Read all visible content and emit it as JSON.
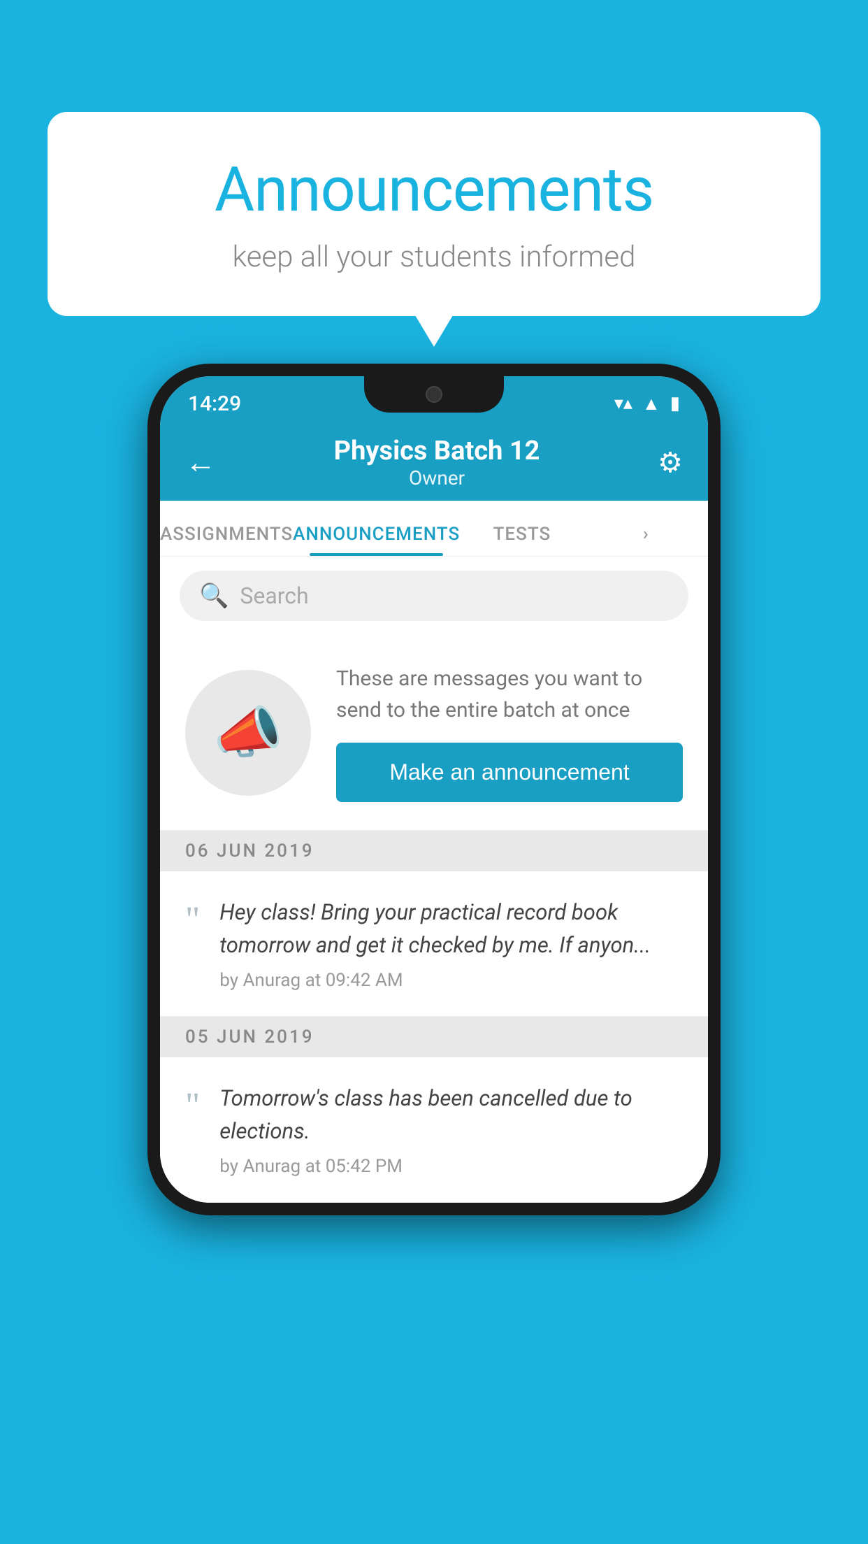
{
  "background": {
    "color": "#1ab3e0"
  },
  "speech_bubble": {
    "title": "Announcements",
    "subtitle": "keep all your students informed"
  },
  "status_bar": {
    "time": "14:29",
    "wifi": "▼",
    "signal": "▲",
    "battery": "▮"
  },
  "app_bar": {
    "back_label": "←",
    "title": "Physics Batch 12",
    "subtitle": "Owner",
    "settings_label": "⚙"
  },
  "tabs": [
    {
      "label": "ASSIGNMENTS",
      "active": false
    },
    {
      "label": "ANNOUNCEMENTS",
      "active": true
    },
    {
      "label": "TESTS",
      "active": false
    },
    {
      "label": "...",
      "active": false
    }
  ],
  "search": {
    "placeholder": "Search"
  },
  "promo": {
    "description": "These are messages you want to send to the entire batch at once",
    "button_label": "Make an announcement"
  },
  "announcements": [
    {
      "date": "06  JUN  2019",
      "text": "Hey class! Bring your practical record book tomorrow and get it checked by me. If anyon...",
      "meta": "by Anurag at 09:42 AM"
    },
    {
      "date": "05  JUN  2019",
      "text": "Tomorrow's class has been cancelled due to elections.",
      "meta": "by Anurag at 05:42 PM"
    }
  ]
}
